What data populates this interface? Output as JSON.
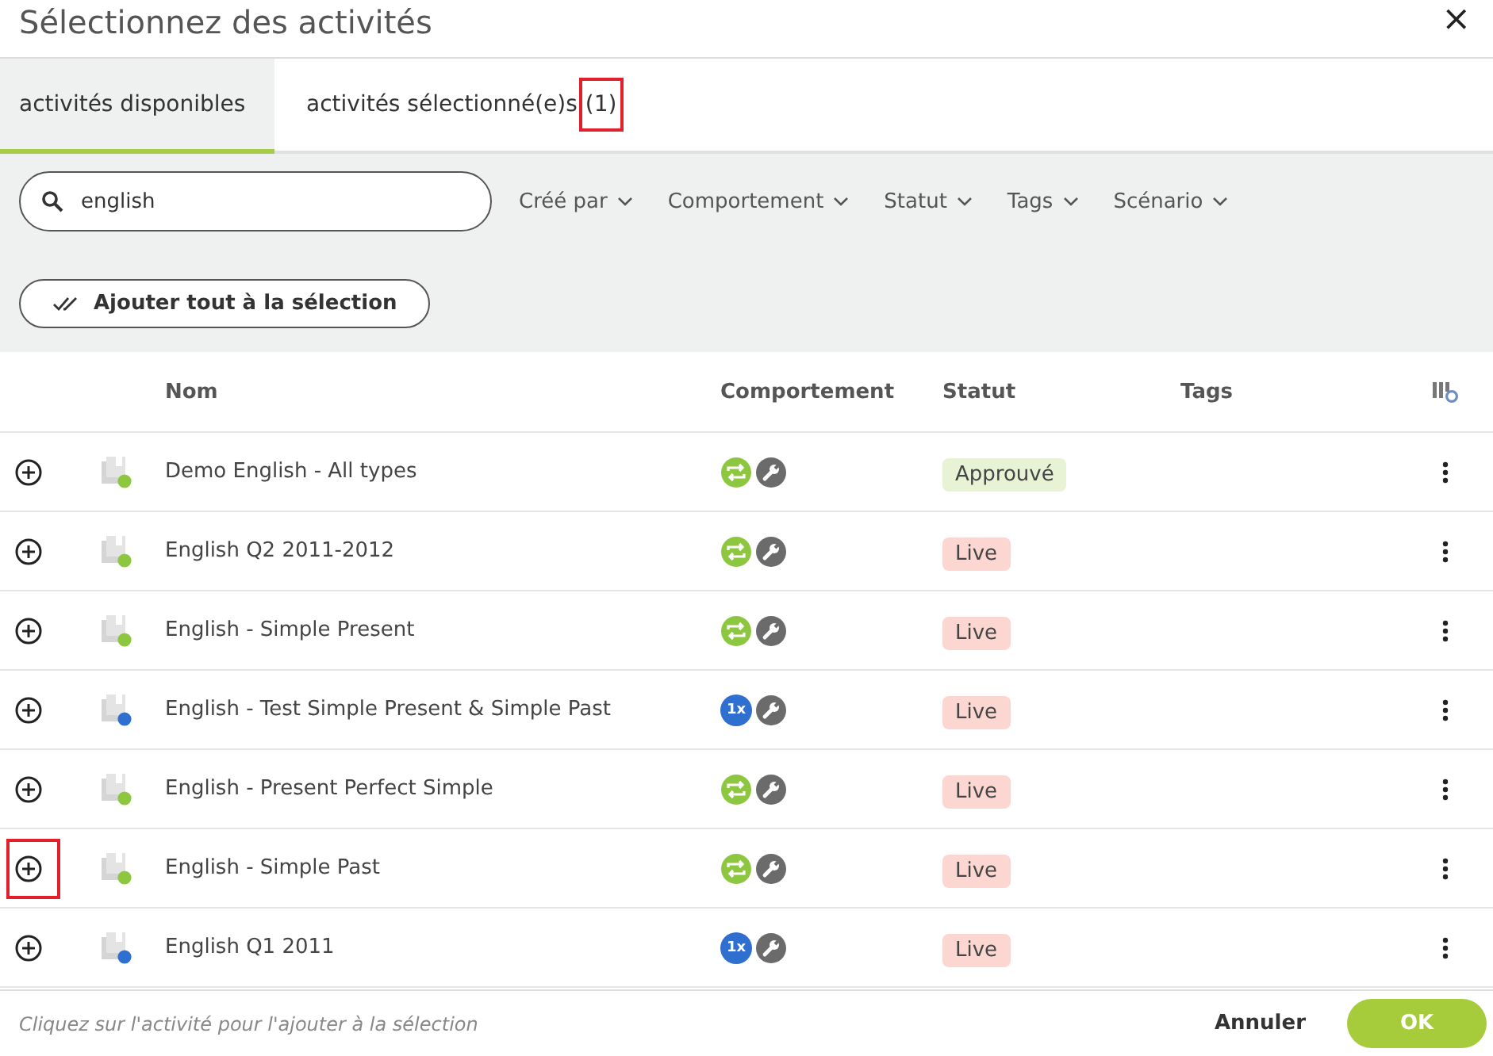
{
  "dialog": {
    "title": "Sélectionnez des activités",
    "close": "×"
  },
  "tabs": [
    {
      "label": "activités disponibles",
      "selected": true
    },
    {
      "label": "activités sélectionné(e)s",
      "count": "(1)",
      "count_highlighted": true,
      "selected": false
    }
  ],
  "search": {
    "value": "english"
  },
  "filters": [
    "Créé par",
    "Comportement",
    "Statut",
    "Tags",
    "Scénario"
  ],
  "add_all_button": "Ajouter tout à la sélection",
  "table": {
    "columns": [
      "Nom",
      "Comportement",
      "Statut",
      "Tags"
    ],
    "rows": [
      {
        "name": "Demo English - All types",
        "kind": "loop",
        "status": {
          "kind": "approved",
          "label": "Approuvé"
        },
        "add_highlighted": false
      },
      {
        "name": "English Q2 2011-2012",
        "kind": "loop",
        "status": {
          "kind": "live",
          "label": "Live"
        },
        "add_highlighted": false
      },
      {
        "name": "English - Simple Present",
        "kind": "loop",
        "status": {
          "kind": "live",
          "label": "Live"
        },
        "add_highlighted": false
      },
      {
        "name": "English - Test Simple Present & Simple Past",
        "kind": "once",
        "mode_label": "1x",
        "status": {
          "kind": "live",
          "label": "Live"
        },
        "add_highlighted": false
      },
      {
        "name": "English - Present Perfect Simple",
        "kind": "loop",
        "status": {
          "kind": "live",
          "label": "Live"
        },
        "add_highlighted": false
      },
      {
        "name": "English - Simple Past",
        "kind": "loop",
        "status": {
          "kind": "live",
          "label": "Live"
        },
        "add_highlighted": true
      },
      {
        "name": "English Q1 2011",
        "kind": "once",
        "mode_label": "1x",
        "status": {
          "kind": "live",
          "label": "Live"
        },
        "add_highlighted": false
      }
    ]
  },
  "footer": {
    "hint": "Cliquez sur l'activité pour l'ajouter à la sélection",
    "cancel": "Annuler",
    "ok": "OK"
  }
}
